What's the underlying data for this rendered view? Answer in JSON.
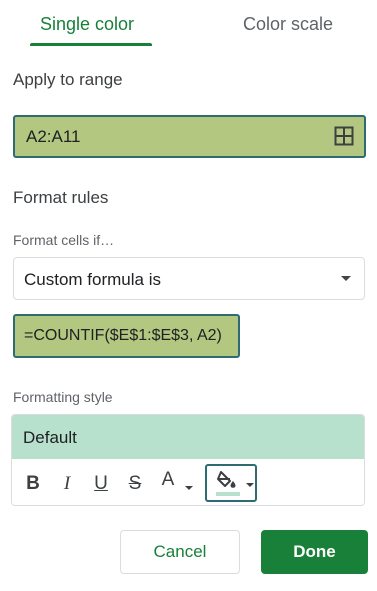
{
  "tabs": [
    {
      "label": "Single color",
      "active": true
    },
    {
      "label": "Color scale",
      "active": false
    }
  ],
  "apply_range": {
    "heading": "Apply to range",
    "value": "A2:A11"
  },
  "format_rules": {
    "heading": "Format rules",
    "condition_label": "Format cells if…",
    "condition_value": "Custom formula is",
    "formula_value": "=COUNTIF($E$1:$E$3, A2)"
  },
  "formatting_style": {
    "label": "Formatting style",
    "preview_text": "Default",
    "preview_color": "#b7e1cd",
    "toolbar": {
      "bold": "B",
      "italic": "I",
      "underline": "U",
      "strikethrough": "S",
      "text_color": "A"
    }
  },
  "actions": {
    "cancel": "Cancel",
    "done": "Done"
  },
  "colors": {
    "accent": "#188038",
    "highlight": "#b3c780",
    "focus_border": "#2e6b73"
  }
}
